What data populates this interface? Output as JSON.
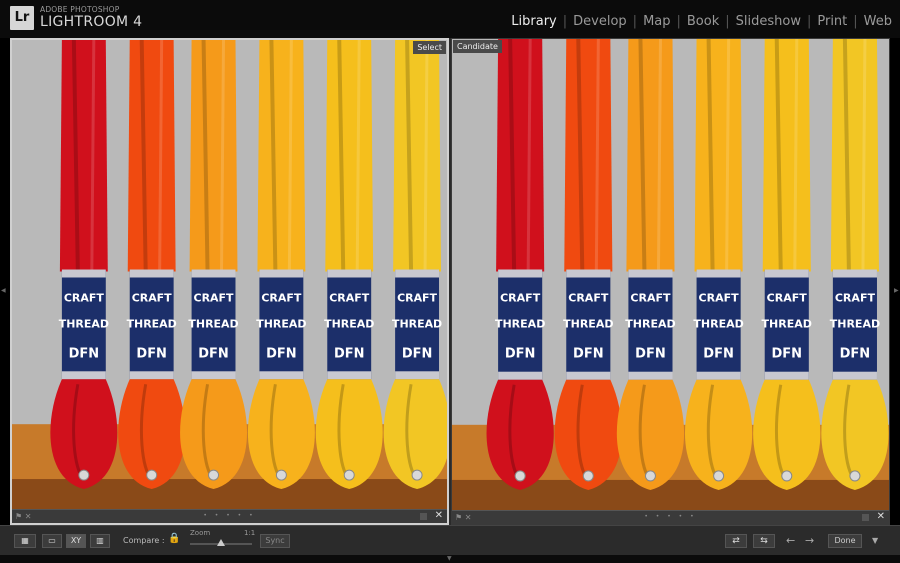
{
  "app": {
    "logo_badge": "Lr",
    "logo_small": "ADOBE PHOTOSHOP",
    "logo_big": "LIGHTROOM 4"
  },
  "modules": [
    {
      "label": "Library",
      "active": true
    },
    {
      "label": "Develop"
    },
    {
      "label": "Map"
    },
    {
      "label": "Book"
    },
    {
      "label": "Slideshow"
    },
    {
      "label": "Print"
    },
    {
      "label": "Web"
    }
  ],
  "compare": {
    "select_label": "Select",
    "candidate_label": "Candidate",
    "thread_label_line1": "CRAFT",
    "thread_label_line2": "THREAD",
    "thread_brand": "DFN",
    "thread_colors": [
      "#d0101c",
      "#f04a10",
      "#f59a1a",
      "#f7b21c",
      "#f5bf1c",
      "#f2c624"
    ]
  },
  "toolbar": {
    "grid_icon": "▦",
    "loupe_icon": "▭",
    "xy_label": "XY",
    "survey_icon": "▥",
    "compare_label": "Compare :",
    "lock_icon": "🔒",
    "zoom_label": "Zoom",
    "zoom_value": "1:1",
    "sync_label": "Sync",
    "swap_icon": "⇄",
    "promote_icon": "⇆",
    "prev_icon": "←",
    "next_icon": "→",
    "done_label": "Done",
    "menu_icon": "▼",
    "zoom_position": 0.5
  },
  "pane_footer": {
    "flag_icon": "⚑ ✕",
    "dots": "• • • • •",
    "close_icon": "✕"
  }
}
